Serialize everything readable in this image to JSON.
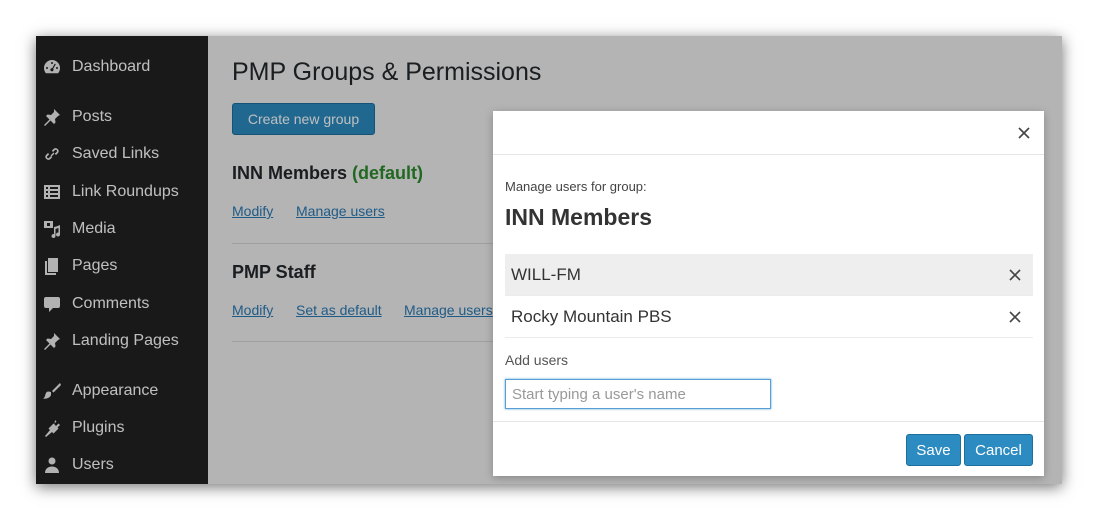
{
  "sidebar": {
    "items": [
      {
        "label": "Dashboard",
        "icon": "dashboard-icon"
      },
      {
        "label": "Posts",
        "icon": "pushpin-icon"
      },
      {
        "label": "Saved Links",
        "icon": "link-icon"
      },
      {
        "label": "Link Roundups",
        "icon": "list-icon"
      },
      {
        "label": "Media",
        "icon": "media-icon"
      },
      {
        "label": "Pages",
        "icon": "pages-icon"
      },
      {
        "label": "Comments",
        "icon": "comment-icon"
      },
      {
        "label": "Landing Pages",
        "icon": "pushpin-icon"
      },
      {
        "label": "Appearance",
        "icon": "brush-icon"
      },
      {
        "label": "Plugins",
        "icon": "plug-icon"
      },
      {
        "label": "Users",
        "icon": "user-icon"
      }
    ]
  },
  "main": {
    "title": "PMP Groups & Permissions",
    "create_button": "Create new group",
    "groups": [
      {
        "name": "INN Members",
        "default_tag": "(default)",
        "links": [
          "Modify",
          "Manage users"
        ]
      },
      {
        "name": "PMP Staff",
        "links": [
          "Modify",
          "Set as default",
          "Manage users"
        ]
      }
    ]
  },
  "modal": {
    "manage_label": "Manage users for group:",
    "group_name": "INN Members",
    "users": [
      "WILL-FM",
      "Rocky Mountain PBS"
    ],
    "add_users_label": "Add users",
    "input_placeholder": "Start typing a user's name",
    "save_button": "Save",
    "cancel_button": "Cancel"
  },
  "colors": {
    "sidebar_bg": "#222222",
    "primary_button": "#2c8bc1",
    "link": "#2a7ab5",
    "default_tag": "#2e8b2e"
  }
}
